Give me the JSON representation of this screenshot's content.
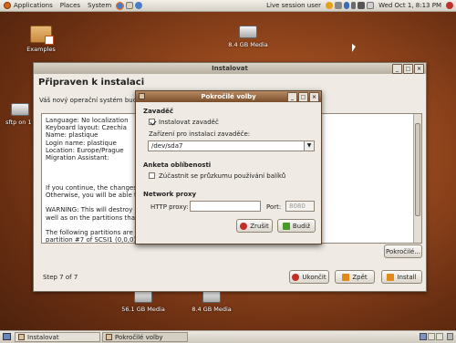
{
  "top_panel": {
    "menus": [
      "Applications",
      "Places",
      "System"
    ],
    "session": "Live session user",
    "datetime": "Wed Oct 1,  8:13 PM"
  },
  "desktop": {
    "icons": [
      {
        "label": "Examples",
        "type": "folder"
      },
      {
        "label": "8.4 GB Media",
        "type": "drive"
      },
      {
        "label": "sftp on 1",
        "type": "drive"
      },
      {
        "label": "56.1 GB Media",
        "type": "drive"
      },
      {
        "label": "8.4 GB Media",
        "type": "drive"
      }
    ]
  },
  "installer": {
    "title": "Instalovat",
    "heading": "Připraven k instalaci",
    "intro": "Váš nový operační systém bude n",
    "summary_lines": [
      "Language: No localization",
      "Keyboard layout: Czechia",
      "Name: plastique",
      "Login name: plastique",
      "Location: Europe/Prague",
      "Migration Assistant:",
      "",
      "",
      "",
      "If you continue, the changes list",
      "Otherwise, you will be able to m",
      "",
      "WARNING: This will destroy all da",
      "well as on the partitions that are",
      "",
      "The following partitions are goin",
      "partition #7 of SCSI1 (0,0,0) (s"
    ],
    "advanced_button": "Pokročilé...",
    "step": "Step 7 of 7",
    "quit_button": "Ukončit",
    "back_button": "Zpět",
    "install_button": "Install"
  },
  "dialog": {
    "title": "Pokročilé volby",
    "bootloader_heading": "Zavaděč",
    "install_bootloader_label": "Instalovat zavaděč",
    "install_bootloader_checked": true,
    "device_label": "Zařízení pro instalaci zavaděče:",
    "device_value": "/dev/sda7",
    "survey_heading": "Anketa oblíbenosti",
    "survey_label": "Zúčastnit se průzkumu používání balíků",
    "survey_checked": false,
    "proxy_heading": "Network proxy",
    "http_proxy_label": "HTTP proxy:",
    "http_proxy_value": "",
    "port_label": "Port:",
    "port_value": "8080",
    "cancel_button": "Zrušit",
    "ok_button": "Budiž"
  },
  "taskbar": {
    "tasks": [
      "Instalovat",
      "Pokročilé volby"
    ]
  }
}
